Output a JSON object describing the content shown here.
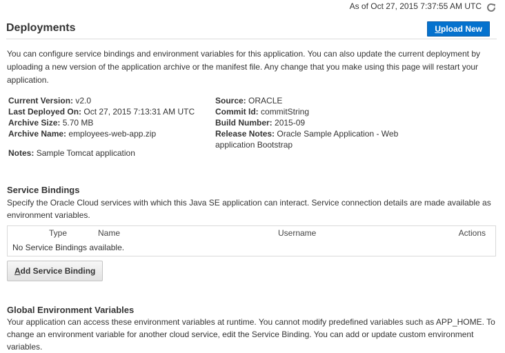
{
  "header": {
    "timestamp": "As of Oct 27, 2015 7:37:55 AM UTC",
    "title": "Deployments",
    "upload_button": {
      "accel": "U",
      "rest": "pload New"
    }
  },
  "intro": "You can configure service bindings and environment variables for this application. You can also update the current deployment by uploading a new version of the application archive or the manifest file. Any change that you make using this page will restart your application.",
  "details": {
    "current_version": {
      "label": "Current Version:",
      "value": "v2.0"
    },
    "last_deployed": {
      "label": "Last Deployed On:",
      "value": "Oct 27, 2015 7:13:31 AM UTC"
    },
    "archive_size": {
      "label": "Archive Size:",
      "value": "5.70 MB"
    },
    "archive_name": {
      "label": "Archive Name:",
      "value": "employees-web-app.zip"
    },
    "notes": {
      "label": "Notes:",
      "value": "Sample Tomcat application"
    },
    "source": {
      "label": "Source:",
      "value": "ORACLE"
    },
    "commit_id": {
      "label": "Commit Id:",
      "value": "commitString"
    },
    "build_number": {
      "label": "Build Number:",
      "value": "2015-09"
    },
    "release_notes": {
      "label": "Release Notes:",
      "value": "Oracle Sample Application - Web application Bootstrap"
    }
  },
  "service_bindings": {
    "title": "Service Bindings",
    "description": "Specify the Oracle Cloud services with which this Java SE application can interact. Service connection details are made available as environment variables.",
    "columns": [
      "Type",
      "Name",
      "Username",
      "Actions"
    ],
    "empty_message": "No Service Bindings available.",
    "add_button": {
      "accel": "A",
      "rest": "dd Service Binding"
    }
  },
  "global_env": {
    "title": "Global Environment Variables",
    "description": "Your application can access these environment variables at runtime. You cannot modify predefined variables such as APP_HOME. To change an environment variable for another cloud service, edit the Service Binding. You can add or update custom environment variables."
  },
  "colors": {
    "accent": "#0572ce",
    "border": "#d9d9d9"
  },
  "icons": {
    "refresh": "refresh-icon"
  }
}
